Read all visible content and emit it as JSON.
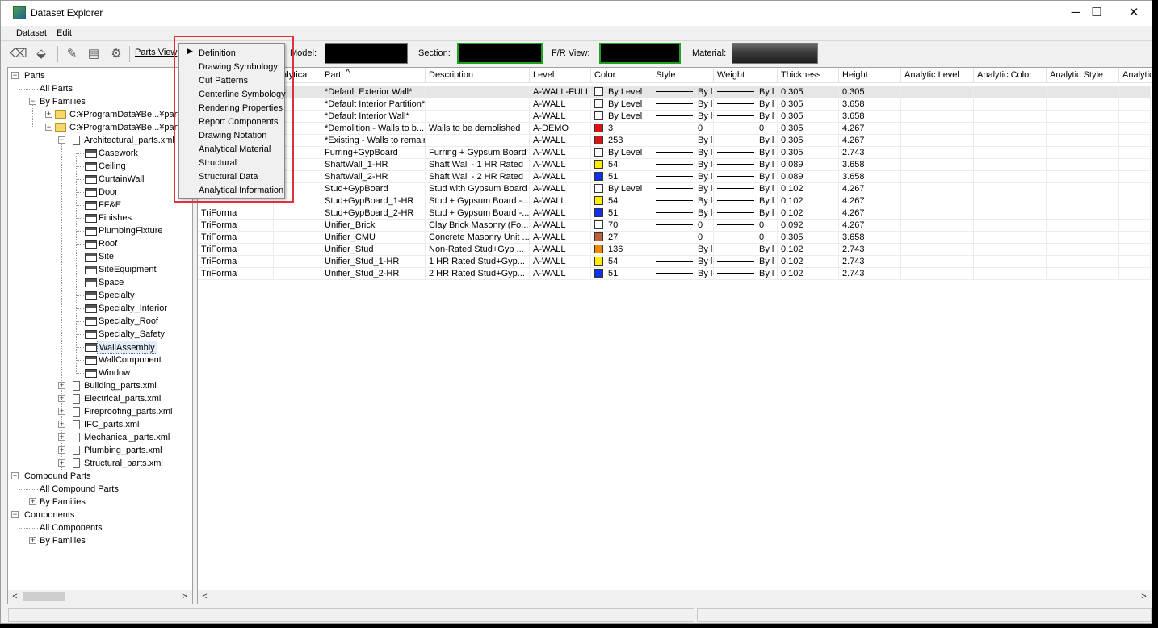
{
  "window": {
    "title": "Dataset Explorer",
    "minimize": "─",
    "maximize": "☐",
    "close": "✕"
  },
  "menubar": {
    "items": [
      {
        "label": "Dataset"
      },
      {
        "label": "Edit"
      }
    ]
  },
  "toolbar": {
    "parts_view": "Parts View",
    "model_label": "Model:",
    "section_label": "Section:",
    "fr_view_label": "F/R View:",
    "material_label": "Material:"
  },
  "context_menu": {
    "items": [
      "Definition",
      "Drawing Symbology",
      "Cut Patterns",
      "Centerline Symbology",
      "Rendering Properties",
      "Report Components",
      "Drawing Notation",
      "Analytical Material",
      "Structural",
      "Structural Data",
      "Analytical Information"
    ],
    "submenu_arrow": "▶"
  },
  "tree": {
    "parts": "Parts",
    "all_parts": "All Parts",
    "by_families": "By Families",
    "folder1": "C:¥ProgramData¥Be...¥partA",
    "folder2": "C:¥ProgramData¥Be...¥partA",
    "arch_xml": "Architectural_parts.xml",
    "arch_children": [
      "Casework",
      "Ceiling",
      "CurtainWall",
      "Door",
      "FF&E",
      "Finishes",
      "PlumbingFixture",
      "Roof",
      "Site",
      "SiteEquipment",
      "Space",
      "Specialty",
      "Specialty_Interior",
      "Specialty_Roof",
      "Specialty_Safety",
      "WallAssembly",
      "WallComponent",
      "Window"
    ],
    "other_xml": [
      "Building_parts.xml",
      "Electrical_parts.xml",
      "Fireproofing_parts.xml",
      "IFC_parts.xml",
      "Mechanical_parts.xml",
      "Plumbing_parts.xml",
      "Structural_parts.xml"
    ],
    "compound_parts": "Compound Parts",
    "all_compound_parts": "All Compound Parts",
    "compound_by_families": "By Families",
    "components": "Components",
    "all_components": "All Components",
    "components_by_families": "By Families"
  },
  "grid": {
    "columns": [
      "",
      "nalytical",
      "Part",
      "Description",
      "Level",
      "Color",
      "Style",
      "Weight",
      "Thickness",
      "Height",
      "Analytic Level",
      "Analytic Color",
      "Analytic Style",
      "Analytic"
    ],
    "sort_indicator": "^",
    "rows": [
      {
        "source": "",
        "part": "*Default Exterior Wall*",
        "desc": "",
        "level": "A-WALL-FULL",
        "color": "By Level",
        "color_hex": "#ffffff",
        "style": "By l",
        "weight": "By l",
        "thickness": "0.305",
        "height": "0.305"
      },
      {
        "source": "",
        "part": "*Default Interior Partition*",
        "desc": "",
        "level": "A-WALL",
        "color": "By Level",
        "color_hex": "#ffffff",
        "style": "By l",
        "weight": "By l",
        "thickness": "0.305",
        "height": "3.658"
      },
      {
        "source": "",
        "part": "*Default Interior Wall*",
        "desc": "",
        "level": "A-WALL",
        "color": "By Level",
        "color_hex": "#ffffff",
        "style": "By l",
        "weight": "By l",
        "thickness": "0.305",
        "height": "3.658"
      },
      {
        "source": "",
        "part": "*Demolition - Walls to b...",
        "desc": "Walls to be demolished",
        "level": "A-DEMO",
        "color": "3",
        "color_hex": "#e01010",
        "style": "0",
        "weight": "0",
        "thickness": "0.305",
        "height": "4.267"
      },
      {
        "source": "",
        "part": "*Existing - Walls to remain",
        "desc": "",
        "level": "A-WALL",
        "color": "253",
        "color_hex": "#d01818",
        "style": "By l",
        "weight": "By l",
        "thickness": "0.305",
        "height": "4.267"
      },
      {
        "source": "",
        "part": "Furring+GypBoard",
        "desc": "Furring + Gypsum Board",
        "level": "A-WALL",
        "color": "By Level",
        "color_hex": "#ffffff",
        "style": "By l",
        "weight": "By l",
        "thickness": "0.305",
        "height": "2.743"
      },
      {
        "source": "",
        "part": "ShaftWall_1-HR",
        "desc": "Shaft Wall - 1 HR Rated",
        "level": "A-WALL",
        "color": "54",
        "color_hex": "#ffee00",
        "style": "By l",
        "weight": "By l",
        "thickness": "0.089",
        "height": "3.658"
      },
      {
        "source": "",
        "part": "ShaftWall_2-HR",
        "desc": "Shaft Wall - 2 HR Rated",
        "level": "A-WALL",
        "color": "51",
        "color_hex": "#1030ee",
        "style": "By l",
        "weight": "By l",
        "thickness": "0.089",
        "height": "3.658"
      },
      {
        "source": "",
        "part": "Stud+GypBoard",
        "desc": "Stud with Gypsum Board",
        "level": "A-WALL",
        "color": "By Level",
        "color_hex": "#ffffff",
        "style": "By l",
        "weight": "By l",
        "thickness": "0.102",
        "height": "4.267"
      },
      {
        "source": "",
        "part": "Stud+GypBoard_1-HR",
        "desc": "Stud + Gypsum Board -...",
        "level": "A-WALL",
        "color": "54",
        "color_hex": "#ffee00",
        "style": "By l",
        "weight": "By l",
        "thickness": "0.102",
        "height": "4.267"
      },
      {
        "source": "TriForma",
        "part": "Stud+GypBoard_2-HR",
        "desc": "Stud + Gypsum Board -...",
        "level": "A-WALL",
        "color": "51",
        "color_hex": "#1030ee",
        "style": "By l",
        "weight": "By l",
        "thickness": "0.102",
        "height": "4.267"
      },
      {
        "source": "TriForma",
        "part": "Unifier_Brick",
        "desc": "Clay Brick Masonry (Fo...",
        "level": "A-WALL",
        "color": "70",
        "color_hex": "#ffffff",
        "style": "0",
        "weight": "0",
        "thickness": "0.092",
        "height": "4.267"
      },
      {
        "source": "TriForma",
        "part": "Unifier_CMU",
        "desc": "Concrete Masonry Unit ...",
        "level": "A-WALL",
        "color": "27",
        "color_hex": "#c0603a",
        "style": "0",
        "weight": "0",
        "thickness": "0.305",
        "height": "3.658"
      },
      {
        "source": "TriForma",
        "part": "Unifier_Stud",
        "desc": "Non-Rated Stud+Gyp ...",
        "level": "A-WALL",
        "color": "136",
        "color_hex": "#ee8800",
        "style": "By l",
        "weight": "By l",
        "thickness": "0.102",
        "height": "2.743"
      },
      {
        "source": "TriForma",
        "part": "Unifier_Stud_1-HR",
        "desc": "1 HR Rated Stud+Gyp...",
        "level": "A-WALL",
        "color": "54",
        "color_hex": "#ffee00",
        "style": "By l",
        "weight": "By l",
        "thickness": "0.102",
        "height": "2.743"
      },
      {
        "source": "TriForma",
        "part": "Unifier_Stud_2-HR",
        "desc": "2 HR Rated Stud+Gyp...",
        "level": "A-WALL",
        "color": "51",
        "color_hex": "#1030ee",
        "style": "By l",
        "weight": "By l",
        "thickness": "0.102",
        "height": "2.743"
      }
    ]
  },
  "scroll": {
    "left": "<",
    "right": ">"
  },
  "colors": {
    "highlight_box": "#e0303a",
    "swatch_border": "#1fa01f"
  }
}
